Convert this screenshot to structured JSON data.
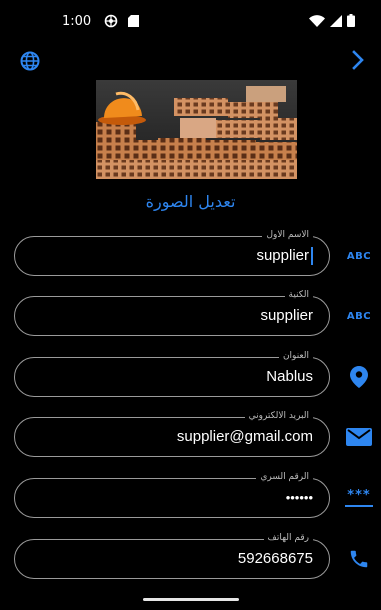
{
  "status_bar": {
    "time": "1:00"
  },
  "edit_photo_label": "تعديل الصورة",
  "fields": [
    {
      "label": "الاسم الاول",
      "value": "supplier",
      "icon": "abc-icon",
      "icon_text": "ABC",
      "focused": true
    },
    {
      "label": "الكنية",
      "value": "supplier",
      "icon": "abc-icon",
      "icon_text": "ABC"
    },
    {
      "label": "العنوان",
      "value": "Nablus",
      "icon": "location-pin-icon"
    },
    {
      "label": "البريد الالكتروني",
      "value": "supplier@gmail.com",
      "icon": "email-icon"
    },
    {
      "label": "الرقم السري",
      "value": "••••••",
      "icon": "password-icon",
      "icon_text": "***"
    },
    {
      "label": "رقم الهاتف",
      "value": "592668675",
      "icon": "phone-icon"
    }
  ],
  "colors": {
    "accent": "#2e86f0",
    "background": "#000000",
    "outline": "#9a9a9a"
  }
}
